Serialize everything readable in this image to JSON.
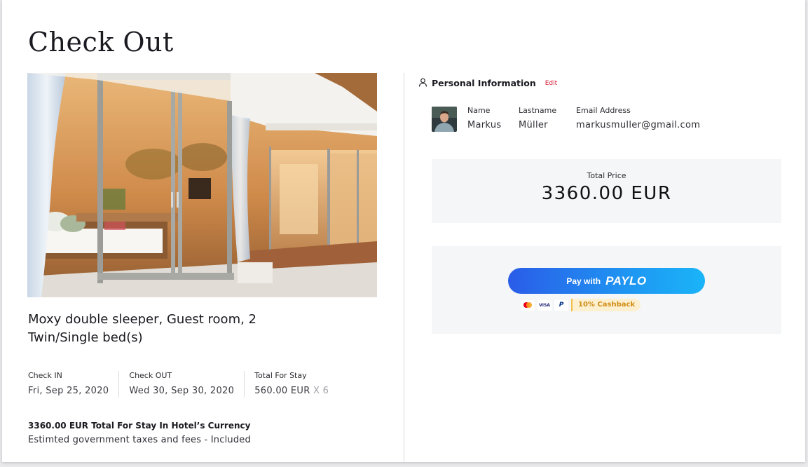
{
  "page": {
    "title": "Check Out"
  },
  "room": {
    "name": "Moxy double sleeper, Guest room, 2 Twin/Single bed(s)",
    "check_in_label": "Check IN",
    "check_in_value": "Fri, Sep 25, 2020",
    "check_out_label": "Check OUT",
    "check_out_value": "Wed 30, Sep 30, 2020",
    "total_label": "Total For Stay",
    "total_value": "560.00 EUR",
    "total_multiplier": "X 6",
    "hotel_total": "3360.00 EUR Total For Stay In Hotel’s Currency",
    "tax_note": "Estimted government taxes and fees - Included"
  },
  "personal_info": {
    "title": "Personal Information",
    "edit_label": "Edit",
    "name_label": "Name",
    "name_value": "Markus",
    "lastname_label": "Lastname",
    "lastname_value": "Müller",
    "email_label": "Email Address",
    "email_value": "markusmuller@gmail.com"
  },
  "price": {
    "label": "Total Price",
    "value": "3360.00 EUR"
  },
  "payment": {
    "pay_with_label": "Pay with",
    "brand": "PAYLO",
    "methods": [
      "mastercard-icon",
      "visa-icon",
      "paypal-icon"
    ],
    "visa_text": "VISA",
    "paypal_text": "P",
    "cashback_label": "10% Cashback"
  },
  "colors": {
    "accent_start": "#2a5ce8",
    "accent_end": "#1ab4f8",
    "edit": "#d6213a",
    "cashback_text": "#d08c15",
    "cashback_bg": "#fdf0d0",
    "panel_bg": "#f5f6f8"
  }
}
